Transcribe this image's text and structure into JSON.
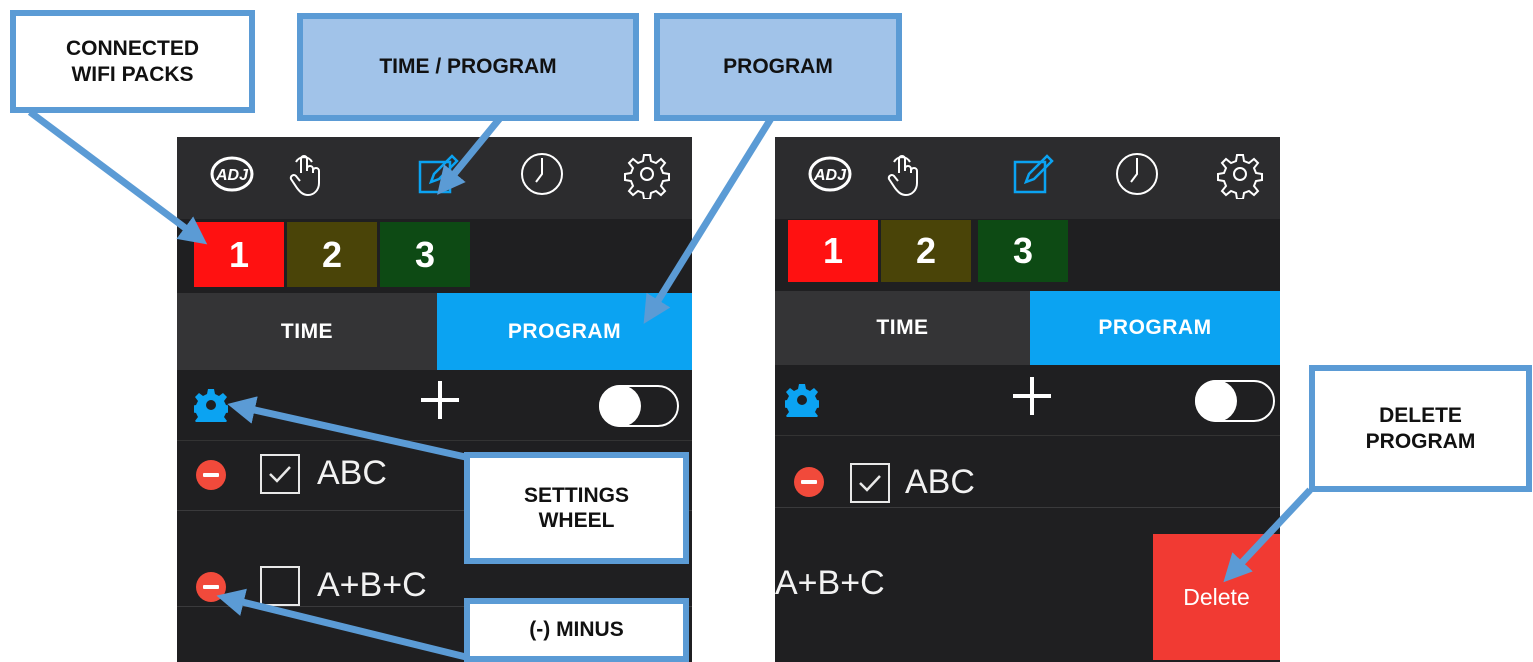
{
  "callouts": {
    "connected_line1": "CONNECTED",
    "connected_line2": "WIFI PACKS",
    "time_program": "TIME / PROGRAM",
    "program": "PROGRAM",
    "settings_line1": "SETTINGS",
    "settings_line2": "WHEEL",
    "minus": "(-) MINUS",
    "delete_line1": "DELETE",
    "delete_line2": "PROGRAM"
  },
  "toolbar_icons": [
    "adj-logo-icon",
    "touch-hand-icon",
    "edit-pencil-icon",
    "clock-icon",
    "settings-gear-icon"
  ],
  "packs": [
    {
      "label": "1",
      "color": "#ff1111"
    },
    {
      "label": "2",
      "color": "#4a4408"
    },
    {
      "label": "3",
      "color": "#0d4a14"
    }
  ],
  "tabs": {
    "time": "TIME",
    "program": "PROGRAM"
  },
  "accent_color": "#0ba3f2",
  "left_screen": {
    "programs": [
      {
        "name": "ABC",
        "checked": true
      },
      {
        "name": "A+B+C",
        "checked": false
      }
    ]
  },
  "right_screen": {
    "programs": [
      {
        "name": "ABC",
        "checked": true
      },
      {
        "name": "A+B+C",
        "swiped": true
      }
    ],
    "delete_label": "Delete"
  }
}
